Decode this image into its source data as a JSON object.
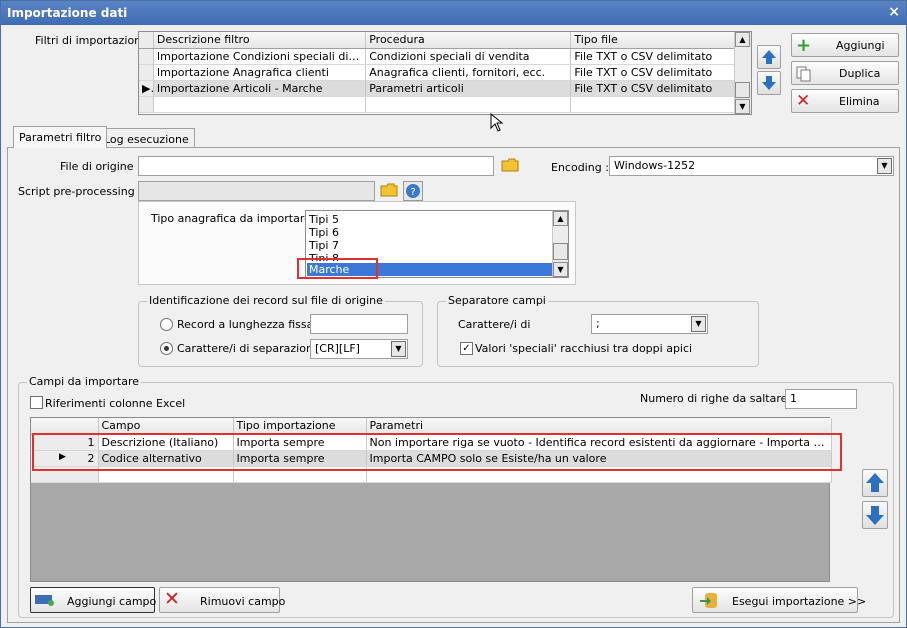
{
  "window": {
    "title": "Importazione dati",
    "close": "×"
  },
  "filters": {
    "label": "Filtri di importazione :",
    "columns": [
      "Descrizione filtro",
      "Procedura",
      "Tipo file"
    ],
    "rows": [
      [
        "Importazione Condizioni speciali di ven…",
        "Condizioni speciali di vendita",
        "File TXT o CSV delimitato"
      ],
      [
        "Importazione Anagrafica clienti",
        "Anagrafica clienti, fornitori, ecc.",
        "File TXT o CSV delimitato"
      ],
      [
        "Importazione Articoli - Marche",
        "Parametri articoli",
        "File TXT o CSV delimitato"
      ]
    ],
    "selected_indicator": "▶"
  },
  "buttons": {
    "add": "Aggiungi",
    "duplicate": "Duplica",
    "delete": "Elimina"
  },
  "tabs": [
    "Parametri filtro",
    "Log esecuzione"
  ],
  "params": {
    "file_label": "File di origine :",
    "file_value": "",
    "encoding_label": "Encoding :",
    "encoding_value": "Windows-1252",
    "script_label": "Script pre-processing :",
    "script_value": "",
    "tipo_label": "Tipo anagrafica da importare :",
    "tipo_options": [
      "Tipi 5",
      "Tipi 6",
      "Tipi 7",
      "Tipi 8",
      "Marche"
    ],
    "ident_title": "Identificazione dei record sul file di origine",
    "radio_fixed": "Record a lunghezza fissa",
    "radio_sep": "Carattere/i di separazione",
    "sep_value": "[CR][LF]",
    "sep_group_title": "Separatore campi",
    "sep_chars_label": "Carattere/i di",
    "sep_chars_value": ";",
    "quote_label": "Valori 'speciali' racchiusi tra doppi apici",
    "quote_checked": "✓"
  },
  "fields": {
    "group_title": "Campi da importare",
    "excel_label": "Riferimenti colonne Excel",
    "skip_label": "Numero di righe da saltare :",
    "skip_value": "1",
    "columns": [
      "Campo",
      "Tipo importazione",
      "Parametri"
    ],
    "rows": [
      [
        "1",
        "Descrizione (Italiano)",
        "Importa sempre",
        "Non importare riga se vuoto - Identifica record esistenti da aggiornare - Importa CAMPO solo ..."
      ],
      [
        "2",
        "Codice alternativo",
        "Importa sempre",
        "Importa CAMPO solo se Esiste/ha un valore"
      ]
    ],
    "selected_indicator": "▶"
  },
  "bottom": {
    "add_field": "Aggiungi campo",
    "remove_field": "Rimuovi campo",
    "run": "Esegui importazione >>"
  }
}
